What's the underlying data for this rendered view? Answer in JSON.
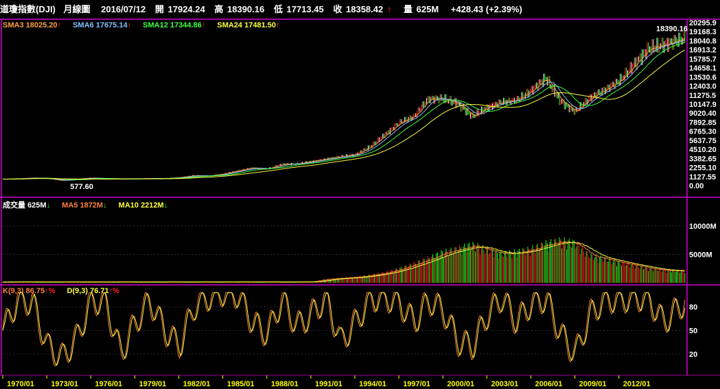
{
  "header": {
    "title": "道瓊指數(DJI)",
    "period": "月線圖",
    "date": "2016/07/12",
    "open_label": "開",
    "open": "17924.24",
    "high_label": "高",
    "high": "18390.16",
    "low_label": "低",
    "low": "17713.45",
    "close_label": "收",
    "close": "18358.42",
    "close_arrow": "↑",
    "volume_label": "量",
    "volume": "625M",
    "change": "+428.43 (+2.39%)"
  },
  "price_legend": [
    {
      "label": "SMA3",
      "value": "18025.20",
      "arrow": "↑",
      "color": "#ffa040"
    },
    {
      "label": "SMA6",
      "value": "17675.14",
      "arrow": "↑",
      "color": "#80c0ff"
    },
    {
      "label": "SMA12",
      "value": "17344.86",
      "arrow": "↑",
      "color": "#40ff40"
    },
    {
      "label": "SMA24",
      "value": "17481.50",
      "arrow": "↑",
      "color": "#ffff40"
    }
  ],
  "volume_legend": [
    {
      "label": "成交量",
      "value": "625M",
      "arrow": "↓",
      "color": "#ffffff"
    },
    {
      "label": "MA5",
      "value": "1872M",
      "arrow": "↓",
      "color": "#ff8040"
    },
    {
      "label": "MA10",
      "value": "2212M",
      "arrow": "↓",
      "color": "#ffff40"
    }
  ],
  "kd_legend": [
    {
      "label": "K(9,3)",
      "value": "86.75",
      "arrow": "↑%",
      "color": "#ff8040"
    },
    {
      "label": "D(9,3)",
      "value": "76.71",
      "arrow": "↑%",
      "color": "#ffff40"
    }
  ],
  "colors": {
    "up": "#ff2020",
    "down": "#20ff20",
    "frame": "#a000a0",
    "grid": "#606060"
  },
  "chart_data": [
    {
      "type": "line",
      "title": "",
      "y_ticks": [
        "20295.9",
        "19168.3",
        "18040.8",
        "16913.2",
        "15785.7",
        "14658.1",
        "13530.6",
        "12403.0",
        "11275.5",
        "10147.9",
        "9020.40",
        "7892.85",
        "6765.30",
        "5637.75",
        "4510.20",
        "3382.65",
        "2255.10",
        "1127.55",
        "0.00"
      ],
      "ylim": [
        0,
        20295.9
      ],
      "annotations": [
        {
          "label": "18390.16",
          "x": "2015/05",
          "y": 18390.16
        },
        {
          "label": "577.60",
          "x": "1974/12",
          "y": 577.6
        }
      ],
      "x": [
        1970,
        1971,
        1972,
        1973,
        1974,
        1975,
        1976,
        1977,
        1978,
        1979,
        1980,
        1981,
        1982,
        1983,
        1984,
        1985,
        1986,
        1987,
        1988,
        1989,
        1990,
        1991,
        1992,
        1993,
        1994,
        1995,
        1996,
        1997,
        1998,
        1999,
        2000,
        2001,
        2002,
        2003,
        2004,
        2005,
        2006,
        2007,
        2008,
        2009,
        2010,
        2011,
        2012,
        2013,
        2014,
        2015,
        2016.5
      ],
      "series": [
        {
          "values": [
            800,
            850,
            950,
            900,
            620,
            800,
            950,
            850,
            800,
            830,
            900,
            880,
            1000,
            1250,
            1200,
            1450,
            1850,
            2200,
            2050,
            2650,
            2700,
            3000,
            3300,
            3600,
            3850,
            4800,
            6300,
            7800,
            8600,
            10800,
            10800,
            10200,
            8600,
            9700,
            10400,
            10600,
            11800,
            13400,
            10500,
            9200,
            10900,
            11900,
            13000,
            15000,
            17000,
            17500,
            18358
          ]
        }
      ]
    },
    {
      "type": "bar",
      "title": "",
      "y_ticks": [
        "10000M",
        "5000M"
      ],
      "ylim": [
        0,
        13000
      ],
      "x": [
        1970,
        1971,
        1972,
        1973,
        1974,
        1975,
        1976,
        1977,
        1978,
        1979,
        1980,
        1981,
        1982,
        1983,
        1984,
        1985,
        1986,
        1987,
        1988,
        1989,
        1990,
        1991,
        1992,
        1993,
        1994,
        1995,
        1996,
        1997,
        1998,
        1999,
        2000,
        2001,
        2002,
        2003,
        2004,
        2005,
        2006,
        2007,
        2008,
        2009,
        2010,
        2011,
        2012,
        2013,
        2014,
        2015,
        2016.5
      ],
      "series": [
        {
          "values": [
            150,
            150,
            150,
            150,
            150,
            150,
            150,
            150,
            150,
            150,
            150,
            150,
            150,
            150,
            150,
            150,
            150,
            150,
            150,
            150,
            150,
            150,
            600,
            750,
            900,
            1200,
            1600,
            2200,
            3000,
            3800,
            4800,
            5300,
            6000,
            5200,
            4600,
            4800,
            5300,
            6100,
            6600,
            6200,
            4300,
            3800,
            3200,
            2800,
            2300,
            2000,
            1872
          ]
        }
      ]
    },
    {
      "type": "line",
      "title": "",
      "y_ticks": [
        "80",
        "50",
        "20"
      ],
      "ylim": [
        0,
        100
      ],
      "x_ticks": [
        "1970/01",
        "1973/01",
        "1976/01",
        "1979/01",
        "1982/01",
        "1985/01",
        "1988/01",
        "1991/01",
        "1994/01",
        "1997/01",
        "2000/01",
        "2003/01",
        "2006/01",
        "2009/01",
        "2012/01"
      ],
      "series": [
        {
          "values": [
            50,
            90,
            85,
            30,
            15,
            40,
            88,
            85,
            20,
            60,
            88,
            50,
            30,
            80,
            92,
            98,
            95,
            60,
            45,
            90,
            55,
            70,
            92,
            35,
            60,
            90,
            92,
            85,
            60,
            88,
            75,
            35,
            30,
            70,
            92,
            60,
            85,
            90,
            45,
            20,
            70,
            90,
            88,
            92,
            90,
            60,
            86.75
          ]
        },
        {
          "values": [
            55,
            85,
            82,
            35,
            20,
            38,
            82,
            82,
            25,
            55,
            82,
            52,
            32,
            75,
            88,
            95,
            92,
            62,
            48,
            85,
            58,
            68,
            88,
            40,
            58,
            85,
            88,
            82,
            62,
            84,
            72,
            40,
            35,
            66,
            88,
            62,
            82,
            86,
            48,
            25,
            66,
            86,
            85,
            88,
            86,
            62,
            76.71
          ]
        }
      ]
    }
  ]
}
